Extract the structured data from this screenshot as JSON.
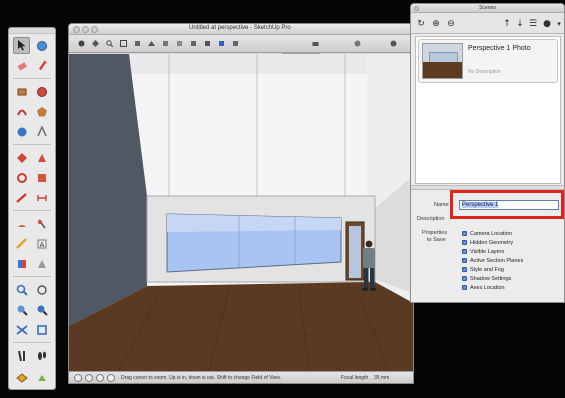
{
  "window": {
    "title": "Untitled at perspective - SketchUp Pro",
    "scene_tab": "Perspective 1",
    "toolbar_icons": [
      "orbit-icon",
      "pan-icon",
      "zoom-icon",
      "zoom-extents-icon",
      "front-view-icon",
      "top-view-icon",
      "perspective-icon",
      "xray-icon",
      "shaded-icon",
      "textured-icon",
      "shadows-icon",
      "section-icon",
      "fog-icon",
      "camera-icon",
      "position-camera-icon"
    ]
  },
  "palette": {
    "tool_icons": [
      "select-icon",
      "paint-bucket-icon",
      "eraser-icon",
      "pencil-icon",
      "rectangle-icon",
      "circle-icon",
      "arc-icon",
      "polygon-icon",
      "move-icon",
      "push-pull-icon",
      "rotate-icon",
      "follow-me-icon",
      "scale-icon",
      "offset-icon",
      "tape-measure-icon",
      "dimension-icon",
      "protractor-icon",
      "text-icon",
      "axes-icon",
      "3d-text-icon",
      "orbit-icon",
      "pan-icon",
      "zoom-icon",
      "zoom-window-icon",
      "zoom-extents-icon",
      "previous-view-icon",
      "position-camera-icon",
      "walk-icon",
      "look-around-icon",
      "section-plane-icon"
    ]
  },
  "status": {
    "hint": "Drag cursor to zoom. Up is in, down is out. Shift to change Field of View.",
    "field_label": "Focal length",
    "field_value": "35 mm"
  },
  "scenes_panel": {
    "title": "Scenes",
    "scene_name": "Perspective 1 Photo",
    "scene_description": "No Description",
    "name_label": "Name",
    "name_value": "Perspective 1",
    "description_label": "Description",
    "properties_label_1": "Properties",
    "properties_label_2": "to Save",
    "properties": [
      "Camera Location",
      "Hidden Geometry",
      "Visible Layers",
      "Active Section Planes",
      "Style and Fog",
      "Shadow Settings",
      "Axes Location"
    ]
  },
  "colors": {
    "sketchup_blue": "#4a7cd6",
    "highlight_red": "#e2231c",
    "floor_brown": "#5a3a22",
    "window_glass": "#a9c3f2"
  }
}
